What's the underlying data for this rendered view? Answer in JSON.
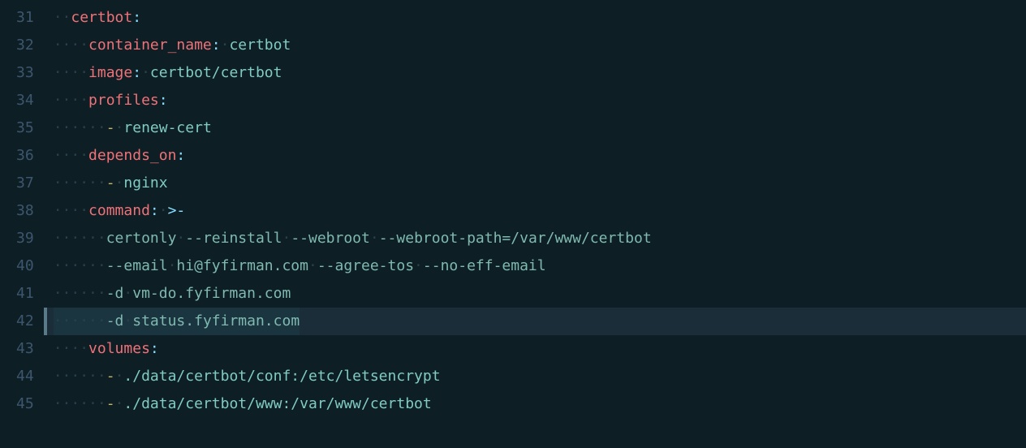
{
  "gutter": {
    "lines": [
      "31",
      "32",
      "33",
      "34",
      "35",
      "36",
      "37",
      "38",
      "39",
      "40",
      "41",
      "42",
      "43",
      "44",
      "45"
    ]
  },
  "code": {
    "l31": {
      "indent": "··",
      "dot1": "·",
      "key": "certbot",
      "colon": ":"
    },
    "l32": {
      "indent": "····",
      "dot1": "·",
      "key": "container_name",
      "colon": ":",
      "sp": "·",
      "val": "certbot"
    },
    "l33": {
      "indent": "····",
      "dot1": "·",
      "key": "image",
      "colon": ":",
      "sp": "·",
      "val": "certbot/certbot"
    },
    "l34": {
      "indent": "····",
      "dot1": "·",
      "key": "profiles",
      "colon": ":"
    },
    "l35": {
      "indent": "······",
      "dot1": "·",
      "dash": "-",
      "sp": "·",
      "val": "renew-cert"
    },
    "l36": {
      "indent": "····",
      "dot1": "·",
      "key": "depends_on",
      "colon": ":"
    },
    "l37": {
      "indent": "······",
      "dot1": "·",
      "dash": "-",
      "sp": "·",
      "val": "nginx"
    },
    "l38": {
      "indent": "····",
      "dot1": "·",
      "key": "command",
      "colon": ":",
      "sp": "·",
      "val": ">-"
    },
    "l39": {
      "indent": "······",
      "dot1": "·",
      "t1": "certonly",
      "s1": "·",
      "t2": "--reinstall",
      "s2": "·",
      "t3": "--webroot",
      "s3": "·",
      "t4": "--webroot-path=/var/www/certbot"
    },
    "l40": {
      "indent": "······",
      "dot1": "·",
      "t1": "--email",
      "s1": "·",
      "t2": "hi@fyfirman.com",
      "s2": "·",
      "t3": "--agree-tos",
      "s3": "·",
      "t4": "--no-eff-email"
    },
    "l41": {
      "indent": "······",
      "dot1": "·",
      "t1": "-d",
      "s1": "·",
      "t2": "vm-do.fyfirman.com"
    },
    "l42": {
      "indent": "······",
      "dot1": "·",
      "t1": "-d",
      "s1": "·",
      "t2": "status.fyfirman.com"
    },
    "l43": {
      "indent": "····",
      "dot1": "·",
      "key": "volumes",
      "colon": ":"
    },
    "l44": {
      "indent": "······",
      "dot1": "·",
      "dash": "-",
      "sp": "·",
      "val": "./data/certbot/conf:/etc/letsencrypt"
    },
    "l45": {
      "indent": "······",
      "dot1": "·",
      "dash": "-",
      "sp": "·",
      "val": "./data/certbot/www:/var/www/certbot"
    }
  }
}
